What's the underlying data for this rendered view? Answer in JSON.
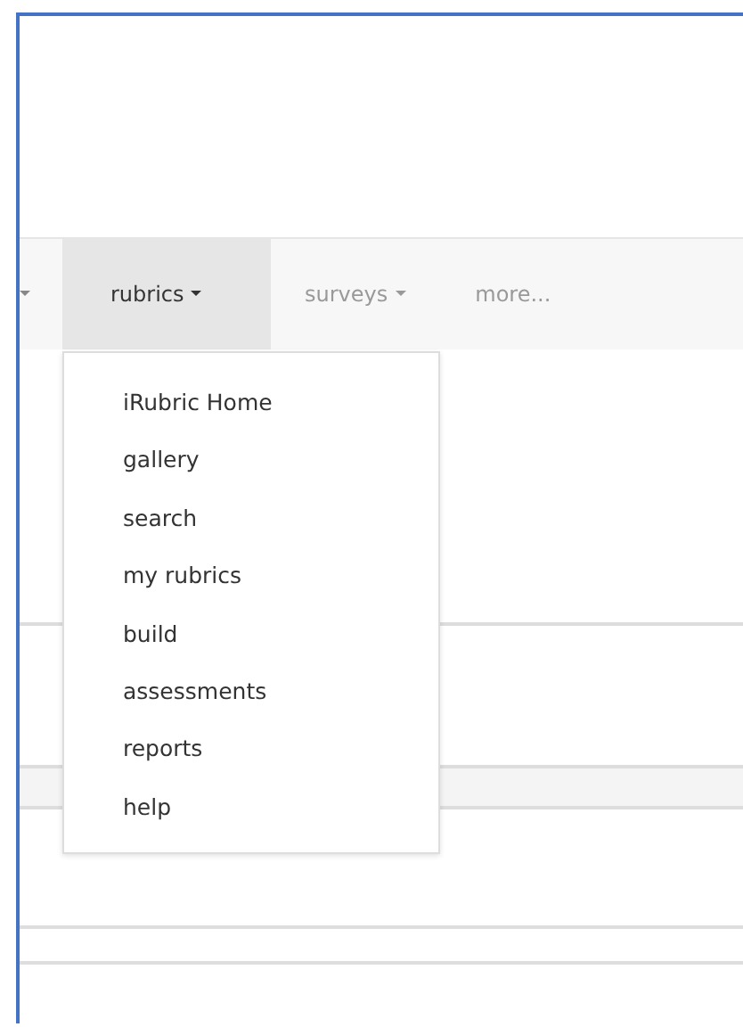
{
  "nav_tabs": [
    {
      "label": "rubrics",
      "caret": true,
      "selected": true
    },
    {
      "label": "surveys",
      "caret": true,
      "selected": false
    },
    {
      "label": "more...",
      "caret": false,
      "selected": false
    }
  ],
  "dropdown_menu": {
    "items": [
      {
        "label": "iRubric Home"
      },
      {
        "label": "gallery"
      },
      {
        "label": "search"
      },
      {
        "label": "my rubrics"
      },
      {
        "label": "build"
      },
      {
        "label": "assessments"
      },
      {
        "label": "reports"
      },
      {
        "label": "help"
      }
    ]
  }
}
